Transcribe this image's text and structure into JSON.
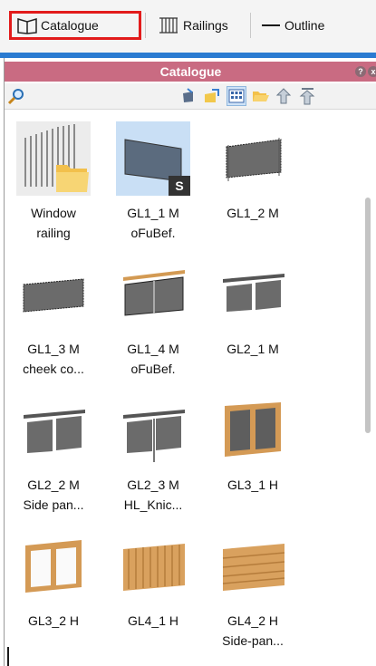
{
  "tabs": [
    {
      "label": "Catalogue",
      "icon": "book-icon"
    },
    {
      "label": "Railings",
      "icon": "railing-icon"
    },
    {
      "label": "Outline",
      "icon": "line-icon"
    }
  ],
  "panel": {
    "title": "Catalogue",
    "toolbar": [
      "search-icon",
      "mug-icon",
      "import-icon",
      "grid-view-icon",
      "folder-open-icon",
      "up-arrow-icon",
      "top-arrow-icon"
    ]
  },
  "items": [
    {
      "label": "Window\nrailing",
      "kind": "folder"
    },
    {
      "label": "GL1_1 M\noFuBef.",
      "kind": "glass",
      "selected": true,
      "badge": "S"
    },
    {
      "label": "GL1_2 M",
      "kind": "glass"
    },
    {
      "label": "GL1_3 M\ncheek co...",
      "kind": "glass"
    },
    {
      "label": "GL1_4 M\noFuBef.",
      "kind": "wood-rail"
    },
    {
      "label": "GL2_1 M",
      "kind": "glass2"
    },
    {
      "label": "GL2_2 M\nSide pan...",
      "kind": "glass2"
    },
    {
      "label": "GL2_3 M\nHL_Knic...",
      "kind": "glass2"
    },
    {
      "label": "GL3_1 H",
      "kind": "wood-frame"
    },
    {
      "label": "GL3_2 H",
      "kind": "wood-frame-white"
    },
    {
      "label": "GL4_1 H",
      "kind": "wood-slats"
    },
    {
      "label": "GL4_2 H\nSide-pan...",
      "kind": "wood-slats"
    }
  ],
  "colors": {
    "title_bg": "#c96b82",
    "accent": "#2a7bd1",
    "highlight": "#e21b1b"
  }
}
